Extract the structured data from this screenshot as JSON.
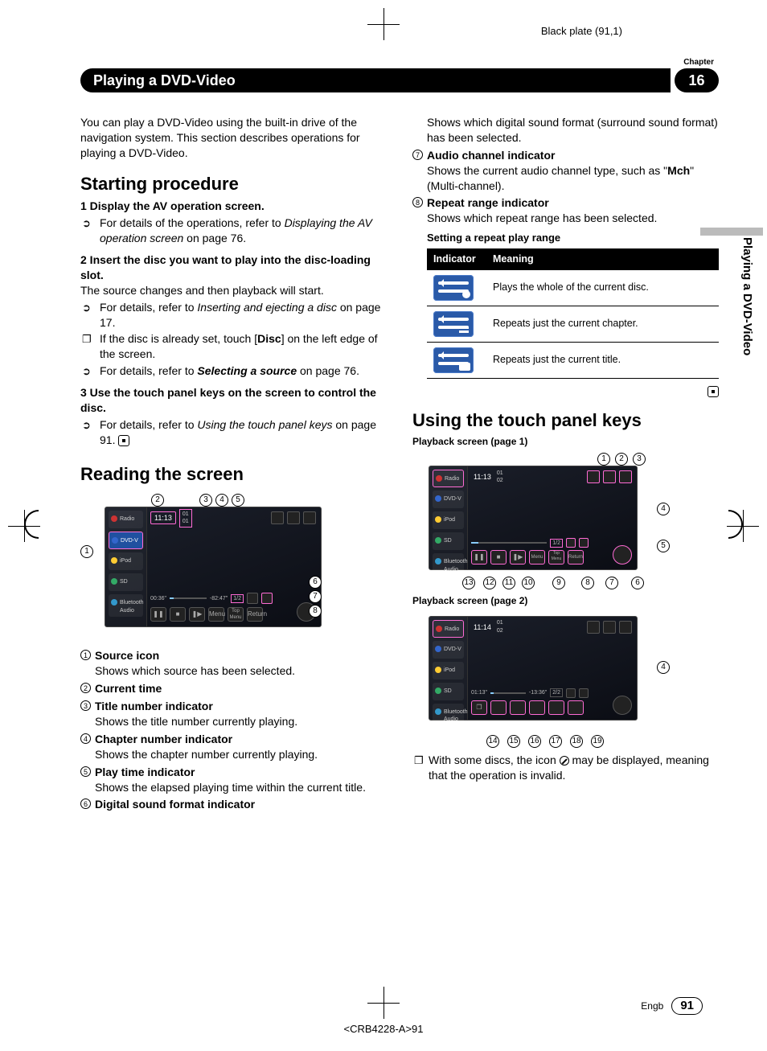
{
  "plate": "Black plate (91,1)",
  "header": {
    "title": "Playing a DVD-Video",
    "chapter_label": "Chapter",
    "chapter_num": "16"
  },
  "side_tab": "Playing a DVD-Video",
  "left": {
    "intro": "You can play a DVD-Video using the built-in drive of the navigation system. This section describes operations for playing a DVD-Video.",
    "section1": "Starting procedure",
    "step1": "1   Display the AV operation screen.",
    "step1_ref_pre": "For details of the operations, refer to ",
    "step1_ref_italic": "Displaying the AV operation screen",
    "step1_ref_post": " on page 76.",
    "step2": "2   Insert the disc you want to play into the disc-loading slot.",
    "step2_body": "The source changes and then playback will start.",
    "step2_a_pre": "For details, refer to ",
    "step2_a_it": "Inserting and ejecting a disc",
    "step2_a_post": " on page 17.",
    "step2_b_pre": "If the disc is already set, touch [",
    "step2_b_bold": "Disc",
    "step2_b_post": "] on the left edge of the screen.",
    "step2_c_pre": "For details, refer to ",
    "step2_c_bi": "Selecting a source",
    "step2_c_post": " on page 76.",
    "step3": "3   Use the touch panel keys on the screen to control the disc.",
    "step3_ref_pre": "For details, refer to ",
    "step3_ref_it": "Using the touch panel keys",
    "step3_ref_post": " on page 91.",
    "section2": "Reading the screen",
    "shot1": {
      "sidebar": [
        "Radio",
        "DVD-V",
        "iPod",
        "SD",
        "Bluetooth Audio"
      ],
      "clock": "11:13",
      "title_chap": "01\n01",
      "prog_l": "00:36\"",
      "prog_r": "-82:47\"",
      "page_ind": "1/2",
      "bot": [
        "",
        "",
        "",
        "Menu",
        "Top Menu",
        "Return"
      ],
      "top_callouts": [
        "2",
        "3",
        "4",
        "5"
      ],
      "left_callout": "1",
      "right_callouts": [
        "6",
        "7",
        "8"
      ]
    },
    "descs": [
      {
        "n": "1",
        "t": "Source icon",
        "d": "Shows which source has been selected."
      },
      {
        "n": "2",
        "t": "Current time",
        "d": ""
      },
      {
        "n": "3",
        "t": "Title number indicator",
        "d": "Shows the title number currently playing."
      },
      {
        "n": "4",
        "t": "Chapter number indicator",
        "d": "Shows the chapter number currently playing."
      },
      {
        "n": "5",
        "t": "Play time indicator",
        "d": "Shows the elapsed playing time within the current title."
      },
      {
        "n": "6",
        "t": "Digital sound format indicator",
        "d": ""
      }
    ]
  },
  "right": {
    "cont_6": "Shows which digital sound format (surround sound format) has been selected.",
    "d7_t": "Audio channel indicator",
    "d7_a": "Shows the current audio channel type, such as \"",
    "d7_bold": "Mch",
    "d7_b": "\" (Multi-channel).",
    "d8_t": "Repeat range indicator",
    "d8_d": "Shows which repeat range has been selected.",
    "table_title": "Setting a repeat play range",
    "th1": "Indicator",
    "th2": "Meaning",
    "row1": "Plays the whole of the current disc.",
    "row2": "Repeats just the current chapter.",
    "row3": "Repeats just the current title.",
    "section3": "Using the touch panel keys",
    "pb1_title": "Playback screen (page 1)",
    "shot2": {
      "clock": "11:13",
      "title_chap": "01\n02",
      "page_ind": "1/2",
      "top_callouts": [
        "1",
        "2",
        "3"
      ],
      "right_callouts": [
        "4",
        "5"
      ],
      "bot_callouts": [
        "13",
        "12",
        "11",
        "10",
        "9",
        "8",
        "7",
        "6"
      ]
    },
    "pb2_title": "Playback screen (page 2)",
    "shot3": {
      "clock": "11:14",
      "title_chap": "01\n02",
      "prog_l": "01:13\"",
      "prog_r": "-13:36\"",
      "page_ind": "2/2",
      "right_callout": "4",
      "bot_callouts": [
        "14",
        "15",
        "16",
        "17",
        "18",
        "19"
      ]
    },
    "note_pre": "With some discs, the icon ",
    "note_post": " may be displayed, meaning that the operation is invalid."
  },
  "footer": {
    "lang": "Engb",
    "page": "91",
    "ref": "<CRB4228-A>91"
  }
}
